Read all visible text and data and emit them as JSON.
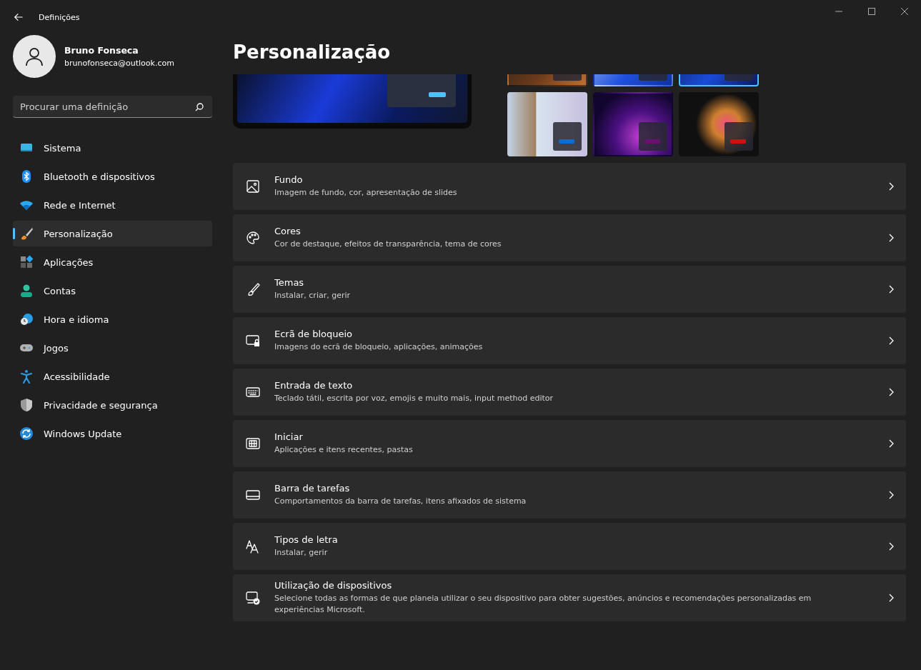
{
  "window": {
    "title": "Definições"
  },
  "user": {
    "name": "Bruno Fonseca",
    "email": "brunofonseca@outlook.com"
  },
  "search": {
    "placeholder": "Procurar uma definição"
  },
  "sidebar": {
    "items": [
      {
        "label": "Sistema",
        "selected": false
      },
      {
        "label": "Bluetooth e dispositivos",
        "selected": false
      },
      {
        "label": "Rede e Internet",
        "selected": false
      },
      {
        "label": "Personalização",
        "selected": true
      },
      {
        "label": "Aplicações",
        "selected": false
      },
      {
        "label": "Contas",
        "selected": false
      },
      {
        "label": "Hora e idioma",
        "selected": false
      },
      {
        "label": "Jogos",
        "selected": false
      },
      {
        "label": "Acessibilidade",
        "selected": false
      },
      {
        "label": "Privacidade e segurança",
        "selected": false
      },
      {
        "label": "Windows Update",
        "selected": false
      }
    ]
  },
  "page": {
    "title": "Personalização"
  },
  "themes": [
    {
      "selected": false
    },
    {
      "selected": false
    },
    {
      "selected": true
    },
    {
      "selected": false
    },
    {
      "selected": false
    },
    {
      "selected": false
    }
  ],
  "settings": [
    {
      "title": "Fundo",
      "subtitle": "Imagem de fundo, cor, apresentação de slides"
    },
    {
      "title": "Cores",
      "subtitle": "Cor de destaque, efeitos de transparência, tema de cores"
    },
    {
      "title": "Temas",
      "subtitle": "Instalar, criar, gerir"
    },
    {
      "title": "Ecrã de bloqueio",
      "subtitle": "Imagens do ecrã de bloqueio, aplicações, animações"
    },
    {
      "title": "Entrada de texto",
      "subtitle": "Teclado tátil, escrita por voz, emojis e muito mais, input method editor"
    },
    {
      "title": "Iniciar",
      "subtitle": "Aplicações e itens recentes, pastas"
    },
    {
      "title": "Barra de tarefas",
      "subtitle": "Comportamentos da barra de tarefas, itens afixados de sistema"
    },
    {
      "title": "Tipos de letra",
      "subtitle": "Instalar, gerir"
    },
    {
      "title": "Utilização de dispositivos",
      "subtitle": "Selecione todas as formas de que planeia utilizar o seu dispositivo para obter sugestões, anúncios e recomendações personalizadas em experiências Microsoft."
    }
  ]
}
